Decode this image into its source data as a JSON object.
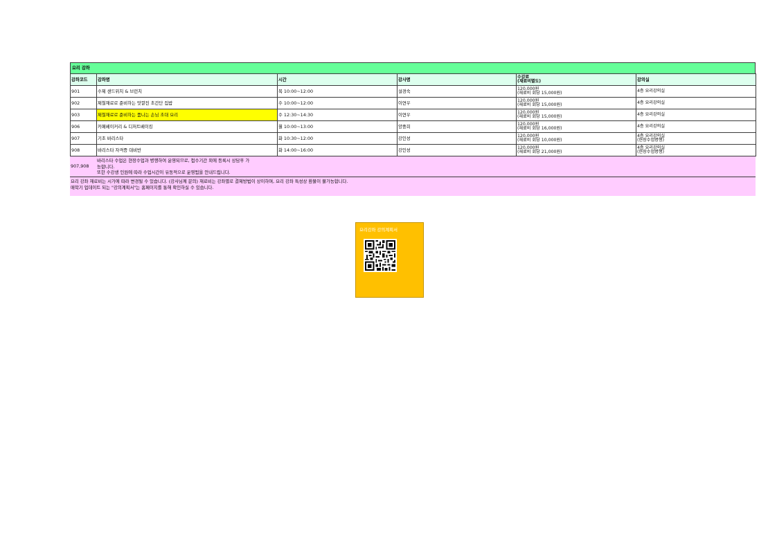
{
  "sheet": {
    "title": "요리 강좌",
    "headers": {
      "code": "강좌코드",
      "name": "강좌명",
      "time": "시간",
      "instructor": "강사명",
      "fee_line1": "수강료",
      "fee_line2": "(재료비별도)",
      "room": "강의실"
    },
    "rows": [
      {
        "code": "901",
        "name": "수제 샌드위치 & 브런치",
        "time": "목 10:00~12:00",
        "instructor": "설경숙",
        "fee": "120,000원",
        "material": "(재료비 회당 15,000원)",
        "room1": "4층 요리강의실",
        "room2": ""
      },
      {
        "code": "902",
        "name": "제철재료로 준비하는 맛깔진 초간단 집밥",
        "time": "수 10:00~12:00",
        "instructor": "이연우",
        "fee": "120,000원",
        "material": "(재료비 회당 15,000원)",
        "room1": "4층 요리강의실",
        "room2": ""
      },
      {
        "code": "903",
        "name": "제철재료로 준비하는 품나는 손님 초대 요리",
        "time": "수 12:30~14:30",
        "instructor": "이연우",
        "fee": "120,000원",
        "material": "(재료비 회당 15,000원)",
        "room1": "4층 요리강의실",
        "room2": ""
      },
      {
        "code": "906",
        "name": "카페베이커리 & 디저트베이킹",
        "time": "월 10:00~13:00",
        "instructor": "양중희",
        "fee": "120,000원",
        "material": "(재료비 회당 16,000원)",
        "room1": "4층 요리강의실",
        "room2": ""
      },
      {
        "code": "907",
        "name": "기초 바리스타",
        "time": "화 10:30~12:00",
        "instructor": "강인성",
        "fee": "120,000원",
        "material": "(재료비 회당 10,000원)",
        "room1": "4층 요리강의실",
        "room2": "(현장수업병행)"
      },
      {
        "code": "908",
        "name": "바리스타 자격증 대비반",
        "time": "화 14:00~16:00",
        "instructor": "강인성",
        "fee": "120,000원",
        "material": "(재료비 회당 21,000원)",
        "room1": "4층 요리강의실",
        "room2": "(현장수업병행)"
      }
    ],
    "note1": {
      "code": "907,908",
      "line1": "바리스타 수업은 현장수업과 병행하여 운영되므로, 접수기간 외에 등록시 상담후 가",
      "line2": "능합니다.",
      "line3": "또한 수강생 인원에 따라 수업시간이 유동적으로 운영됨을 안내드립니다."
    },
    "note2": {
      "line1": "요리 강좌 재료비는 시가에 따라 변경될 수 있습니다. (강사님께 문의) 재료비는 강좌별로 결제방법이 상이하며, 요리 강좌 특성상 환불이 불가능합니다.",
      "line2": "매학기 업데이트 되는 \"강의계획서\"는 홈페이지를 통해 확인하실 수 있습니다."
    }
  },
  "qr_card": {
    "title": "요리강좌 강의계획서",
    "icon": "qr-code-icon"
  },
  "colors": {
    "title_bg": "#66ff99",
    "header_bg": "#ddffee",
    "highlight": "#ffff00",
    "note_bg": "#ffccff",
    "card_bg": "#ffc000"
  }
}
